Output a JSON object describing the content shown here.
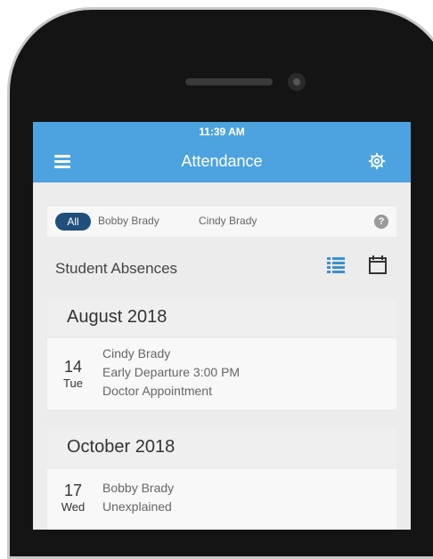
{
  "status_bar": {
    "time": "11:39 AM"
  },
  "header": {
    "title": "Attendance",
    "menu_icon": "hamburger-menu-icon",
    "settings_icon": "gear-icon"
  },
  "filters": {
    "all_label": "All",
    "students": [
      "Bobby Brady",
      "Cindy Brady"
    ],
    "help_icon": "question-icon",
    "help_glyph": "?"
  },
  "section": {
    "title": "Student Absences"
  },
  "months": [
    {
      "label": "August 2018",
      "entries": [
        {
          "day": "14",
          "weekday": "Tue",
          "lines": [
            "Cindy Brady",
            "Early Departure 3:00 PM",
            "Doctor Appointment"
          ]
        }
      ]
    },
    {
      "label": "October 2018",
      "entries": [
        {
          "day": "17",
          "weekday": "Wed",
          "lines": [
            "Bobby Brady",
            "Unexplained"
          ]
        }
      ]
    }
  ],
  "colors": {
    "accent": "#4da3e0",
    "chip_active": "#1f4f7a"
  }
}
